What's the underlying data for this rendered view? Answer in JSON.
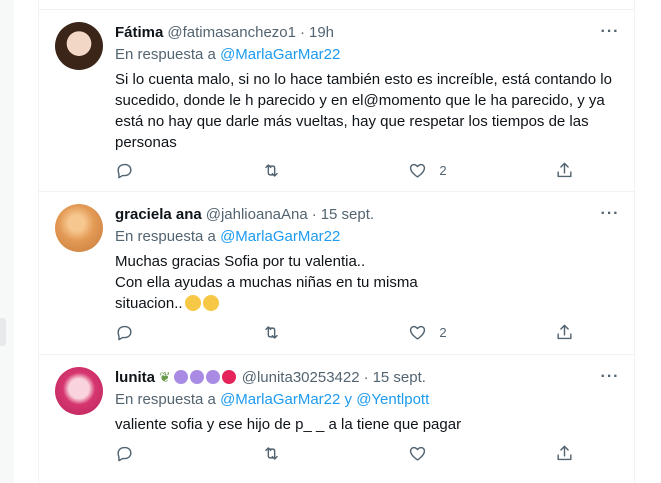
{
  "tweets": [
    {
      "name": "Fátima",
      "handle": "@fatimasanchezo1",
      "time": "19h",
      "replying_prefix": "En respuesta a ",
      "replying_to": "@MarlaGarMar22",
      "text": "Si lo cuenta malo, si no lo hace también esto es increíble, está contando lo sucedido, donde le h parecido y en el@momento que le ha parecido, y ya está no hay que darle más vueltas, hay que respetar los tiempos de las personas",
      "likes": "2"
    },
    {
      "name": "graciela ana",
      "handle": "@jahlioanaAna",
      "time": "15 sept.",
      "replying_prefix": "En respuesta a ",
      "replying_to": "@MarlaGarMar22",
      "text_line1": "Muchas gracias Sofia por tu valentia..",
      "text_line2": "Con ella ayudas a muchas niñas en tu misma",
      "text_line3": "situacion..",
      "likes": "2"
    },
    {
      "name": "lunita",
      "handle": "@lunita30253422",
      "time": "15 sept.",
      "replying_prefix": "En respuesta a ",
      "replying_to": "@MarlaGarMar22",
      "replying_join": " y ",
      "replying_to_2": "@Yentlpott",
      "text": "valiente sofia y ese hijo de p_ _ a la tiene que pagar",
      "likes": ""
    }
  ],
  "more_glyph": "···"
}
